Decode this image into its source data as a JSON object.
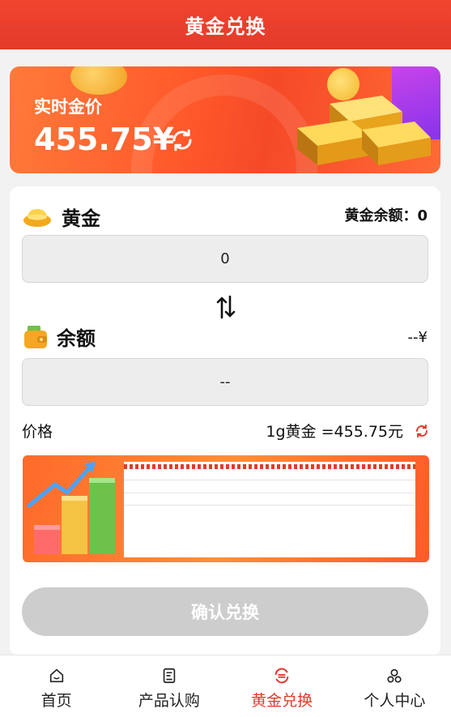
{
  "header": {
    "title": "黄金兑换"
  },
  "banner": {
    "label": "实时金价",
    "price": "455.75¥",
    "refresh_icon": "refresh-icon"
  },
  "gold": {
    "title": "黄金",
    "balance_label": "黄金余额：0",
    "input_value": "0",
    "icon": "gold-ingot-icon"
  },
  "swap_icon": "swap-arrows-icon",
  "balance": {
    "title": "余额",
    "right_value": "--¥",
    "input_value": "--",
    "icon": "wallet-icon"
  },
  "price": {
    "label": "价格",
    "value": "1g黄金 =455.75元",
    "refresh_icon": "refresh-icon"
  },
  "confirm": {
    "label": "确认兑换"
  },
  "tabs": [
    {
      "label": "首页",
      "icon": "home-icon"
    },
    {
      "label": "产品认购",
      "icon": "document-icon"
    },
    {
      "label": "黄金兑换",
      "icon": "exchange-icon",
      "active": true
    },
    {
      "label": "个人中心",
      "icon": "user-icon"
    }
  ],
  "colors": {
    "brand": "#e33a2a",
    "disabled": "#cdcdcd"
  }
}
